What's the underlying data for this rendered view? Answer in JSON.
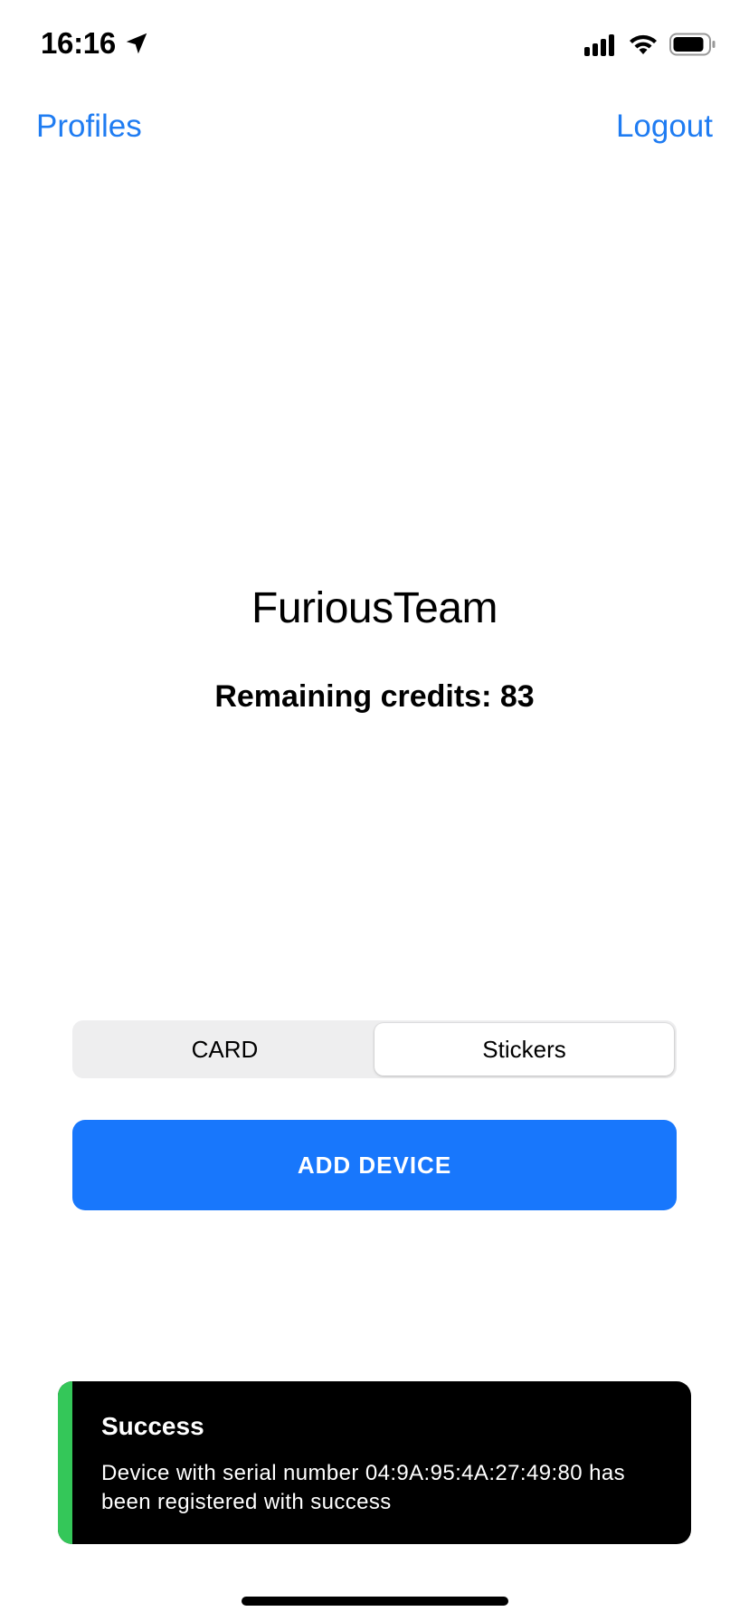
{
  "status_bar": {
    "time": "16:16",
    "location_icon": "location-arrow-icon",
    "signal_icon": "cellular-signal-icon",
    "wifi_icon": "wifi-icon",
    "battery_icon": "battery-icon"
  },
  "nav": {
    "left_label": "Profiles",
    "right_label": "Logout"
  },
  "main": {
    "team_name": "FuriousTeam",
    "credits": "Remaining credits: 83"
  },
  "segmented": {
    "options": [
      "CARD",
      "Stickers"
    ],
    "selected": "Stickers"
  },
  "add_button": {
    "label": "ADD DEVICE"
  },
  "toast": {
    "title": "Success",
    "message": "Device with serial number 04:9A:95:4A:27:49:80 has been registered with success"
  },
  "colors": {
    "accent_link": "#1f7cf2",
    "primary_button": "#1877fc",
    "success": "#34c759",
    "toast_background": "#000000"
  }
}
